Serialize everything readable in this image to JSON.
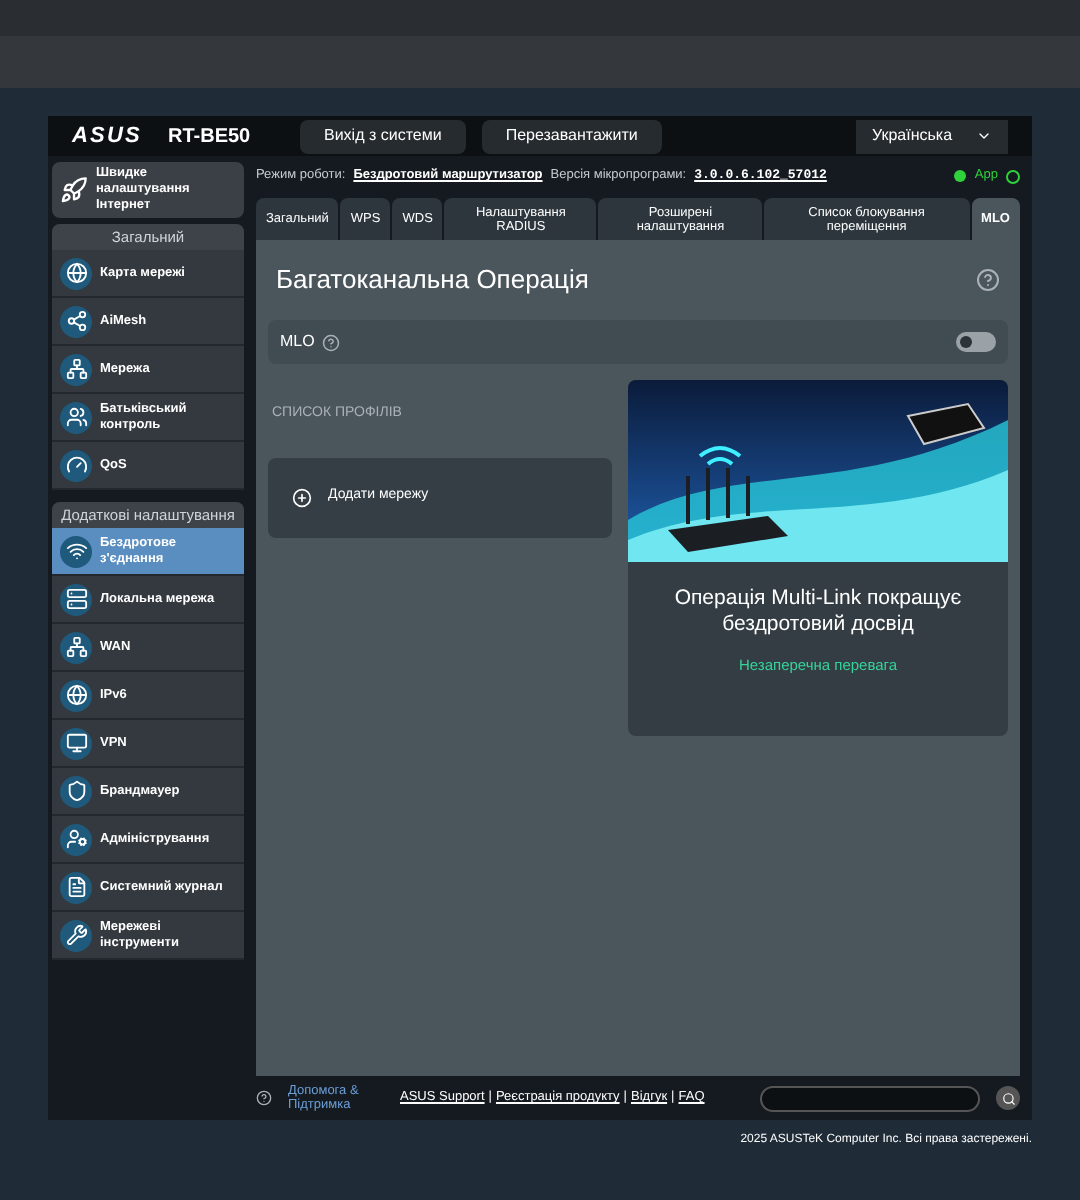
{
  "header": {
    "logo": "ASUS",
    "model": "RT-BE50",
    "buttons": [
      "Вихід з системи",
      "Перезавантажити"
    ],
    "language": "Українська"
  },
  "status": {
    "mode_label": "Режим роботи:",
    "mode": "Бездротовий маршрутизатор",
    "firmware_label": "Версія мікропрограми:",
    "firmware": "3.0.0.6.102_57012",
    "app": "App"
  },
  "sidebar": {
    "quick": "Швидке налаштування Інтернет",
    "sections": [
      {
        "title": "Загальний",
        "items": [
          {
            "label": "Карта мережі",
            "selected": false
          },
          {
            "label": "AiMesh",
            "selected": false
          },
          {
            "label": "Мережа",
            "selected": false
          },
          {
            "label": "Батьківський контроль",
            "selected": false
          },
          {
            "label": "QoS",
            "selected": false
          }
        ]
      },
      {
        "title": "Додаткові налаштування",
        "items": [
          {
            "label": "Бездротове з'єднання",
            "selected": true
          },
          {
            "label": "Локальна мережа",
            "selected": false
          },
          {
            "label": "WAN",
            "selected": false
          },
          {
            "label": "IPv6",
            "selected": false
          },
          {
            "label": "VPN",
            "selected": false
          },
          {
            "label": "Брандмауер",
            "selected": false
          },
          {
            "label": "Адміністрування",
            "selected": false
          },
          {
            "label": "Системний журнал",
            "selected": false
          },
          {
            "label": "Мережеві інструменти",
            "selected": false
          }
        ]
      }
    ]
  },
  "tabs": [
    {
      "label": "Загальний",
      "selected": false
    },
    {
      "label": "WPS",
      "selected": false
    },
    {
      "label": "WDS",
      "selected": false
    },
    {
      "label": "Налаштування RADIUS",
      "selected": false
    },
    {
      "label": "Розширені налаштування",
      "selected": false
    },
    {
      "label": "Список блокування переміщення",
      "selected": false
    },
    {
      "label": "MLO",
      "selected": true
    }
  ],
  "panel": {
    "title": "Багатоканальна Операція",
    "mlo": {
      "label": "MLO",
      "on": false
    },
    "profiles_title": "СПИСОК ПРОФІЛІВ",
    "add": "Додати мережу",
    "promo": {
      "title": "Операція Multi-Link покращує бездротовий досвід",
      "link": "Незаперечна перевага"
    }
  },
  "footer": {
    "help": "Допомога & Підтримка",
    "separator": "|",
    "links": [
      "ASUS Support",
      "Реєстрація продукту",
      "Відгук",
      "FAQ"
    ],
    "copyright": "2025 ASUSTeK Computer Inc. Всі права застережені."
  }
}
